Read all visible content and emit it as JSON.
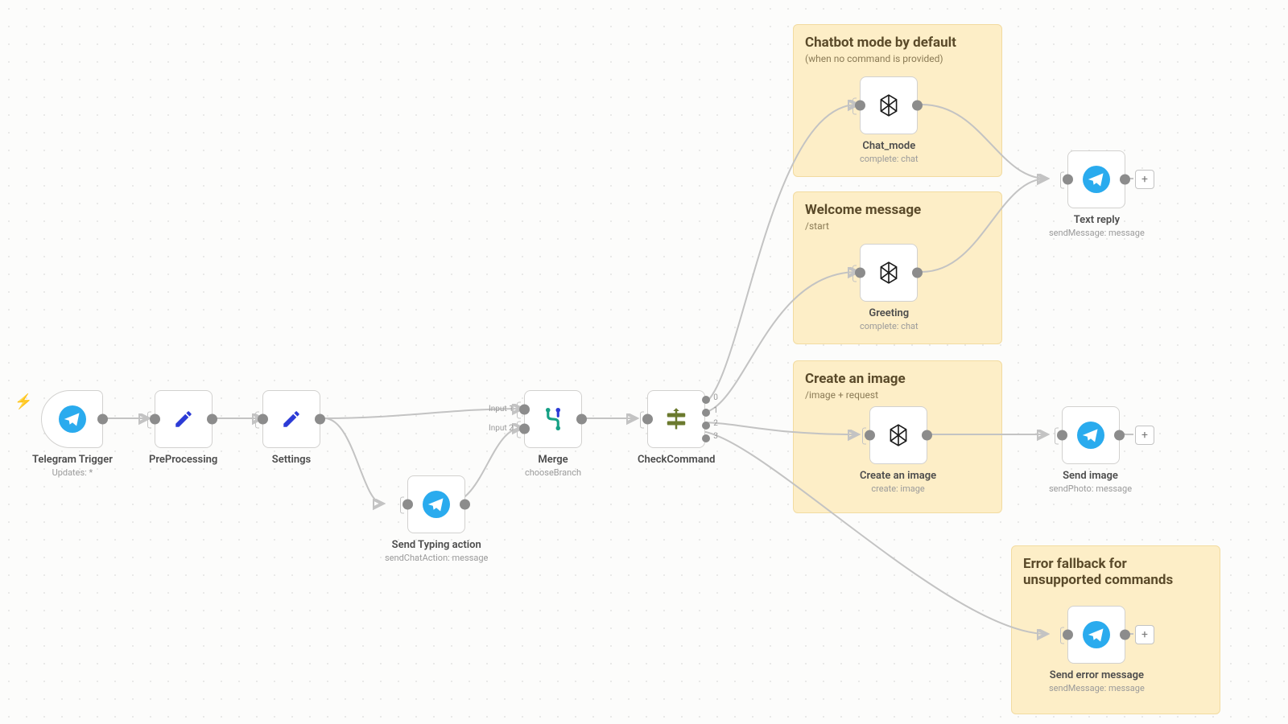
{
  "nodes": {
    "telegram_trigger": {
      "title": "Telegram Trigger",
      "sub": "Updates: *"
    },
    "preprocessing": {
      "title": "PreProcessing",
      "sub": ""
    },
    "settings": {
      "title": "Settings",
      "sub": ""
    },
    "send_typing": {
      "title": "Send Typing action",
      "sub": "sendChatAction: message"
    },
    "merge": {
      "title": "Merge",
      "sub": "chooseBranch",
      "input1": "Input 1",
      "input2": "Input 2"
    },
    "check_command": {
      "title": "CheckCommand",
      "sub": "",
      "outs": [
        "0",
        "1",
        "2",
        "3"
      ]
    },
    "chat_mode": {
      "title": "Chat_mode",
      "sub": "complete: chat"
    },
    "greeting": {
      "title": "Greeting",
      "sub": "complete: chat"
    },
    "create_image": {
      "title": "Create an image",
      "sub": "create: image"
    },
    "text_reply": {
      "title": "Text reply",
      "sub": "sendMessage: message"
    },
    "send_image": {
      "title": "Send image",
      "sub": "sendPhoto: message"
    },
    "send_error": {
      "title": "Send error message",
      "sub": "sendMessage: message"
    }
  },
  "stickies": {
    "chat_default": {
      "title": "Chatbot mode by default",
      "sub": "(when no command is provided)"
    },
    "welcome": {
      "title": "Welcome message",
      "sub": "/start"
    },
    "create_img": {
      "title": "Create an image",
      "sub": "/image + request"
    },
    "error": {
      "title": "Error fallback for unsupported commands",
      "sub": ""
    }
  },
  "icons": {
    "plus": "+"
  }
}
